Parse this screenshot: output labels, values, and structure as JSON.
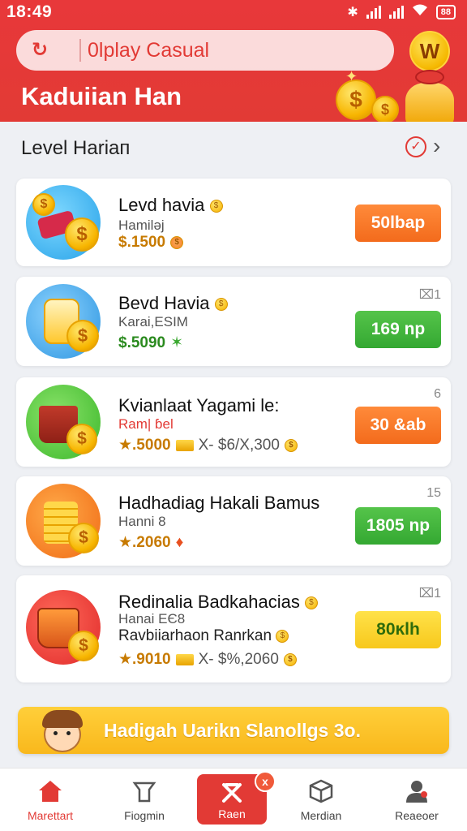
{
  "status_bar": {
    "time": "18:49",
    "battery": "88"
  },
  "header": {
    "search_value": "0lplay Casual",
    "coin_button_label": "W",
    "title": "Kaduiian Han"
  },
  "section": {
    "title": "Level Hariап"
  },
  "cards": [
    {
      "title": "Levd havia",
      "sub": "Hamiləj",
      "reward": "$.1500",
      "button": "50lbap",
      "count": ""
    },
    {
      "title": "Bevd Havia",
      "sub": "Karai,ESIM",
      "reward": "$.5090",
      "button": "169 np",
      "count": "⌧1"
    },
    {
      "title": "Kvianlaat Yagami le:",
      "sub": "Ram| ɓel",
      "reward": "★.5000",
      "reward_extra": "X- $6/X,300",
      "button": "30 &ab",
      "count": "6"
    },
    {
      "title": "Hadhadiag Hakali Bamus",
      "sub": "Hanni 8",
      "reward": "★.2060",
      "button": "1805 np",
      "count": "15"
    },
    {
      "title": "Redinalia Badkahacias",
      "sub": "Hanai EЄ8",
      "sub2": "Ravbiiarhaon Ranrkan",
      "reward": "★.9010",
      "reward_extra": "X- $%,2060",
      "button": "80ĸlh",
      "count": "⌧1"
    }
  ],
  "banner": {
    "text": "Hadigah Uarikn Slanollgs 3o."
  },
  "nav": {
    "items": [
      "Marettart",
      "Fiogmin",
      "Raen",
      "Merdian",
      "Reaeoer"
    ],
    "badge": "x"
  },
  "colors": {
    "primary": "#e23a35",
    "orange_button": "#f36b1c",
    "green_button": "#34a832",
    "yellow_button": "#f7c81c"
  },
  "icons": [
    "refresh-icon",
    "coin-icon",
    "check-circle-icon",
    "chevron-right-icon",
    "home-icon",
    "bag-icon",
    "tool-icon",
    "box-icon",
    "user-icon"
  ]
}
